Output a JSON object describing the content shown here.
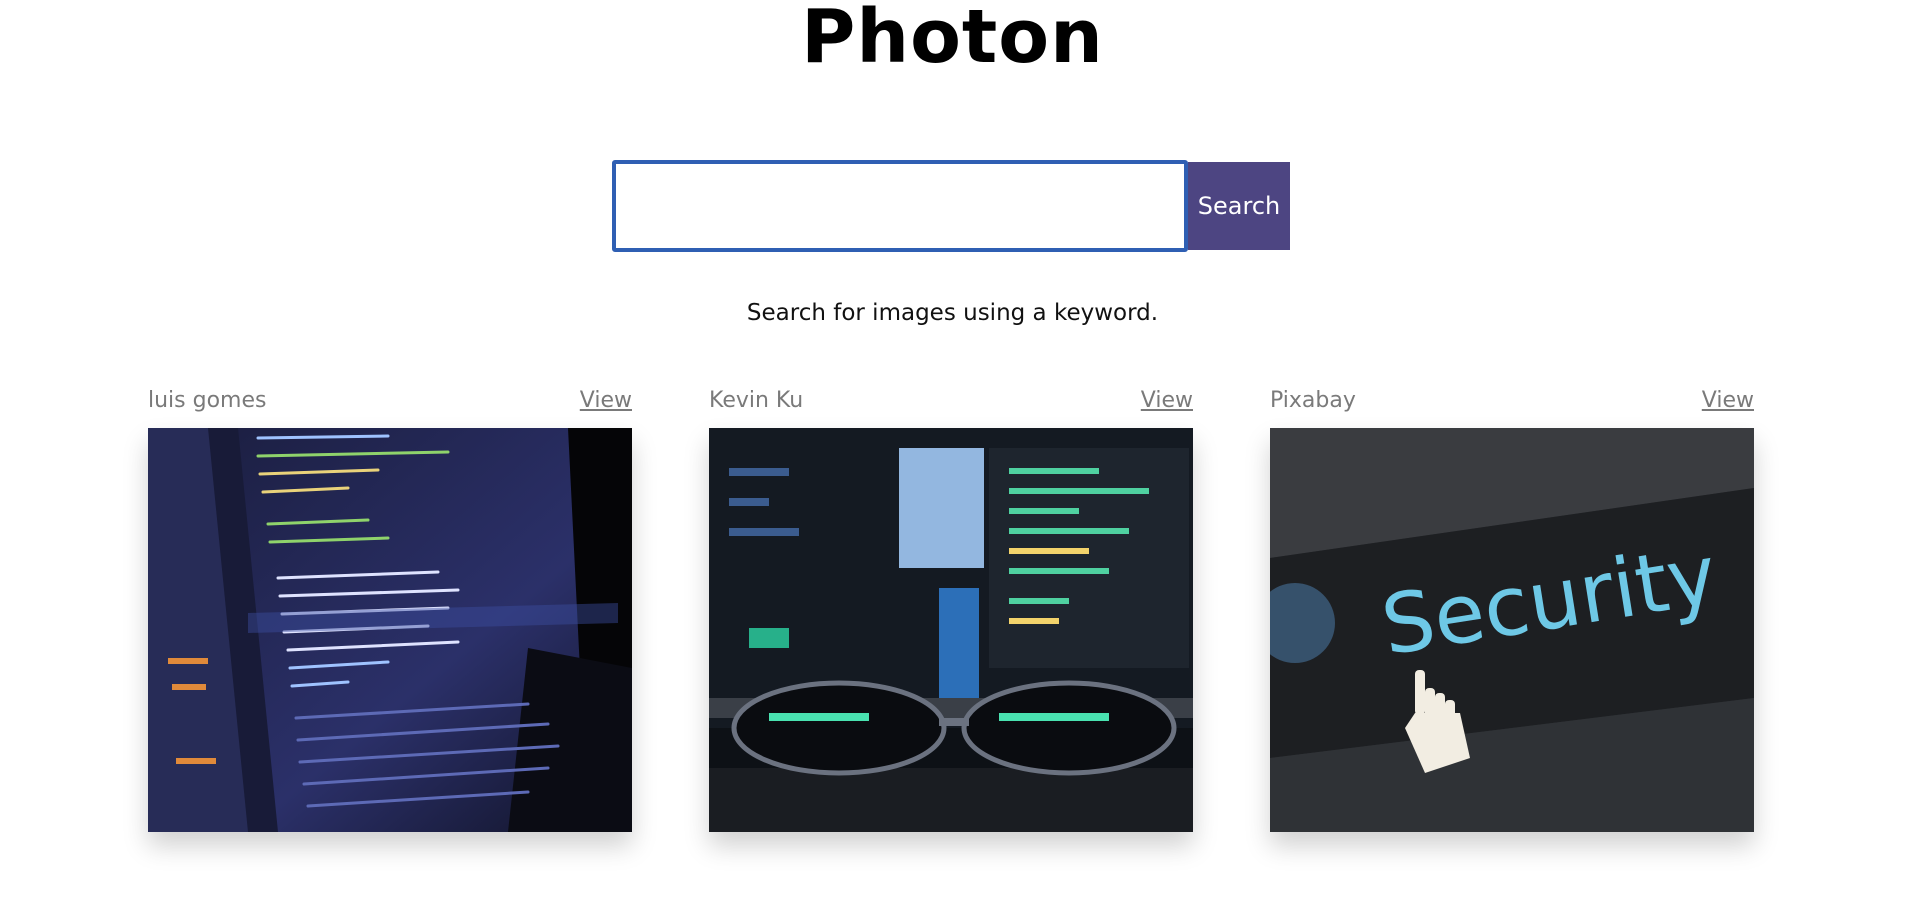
{
  "header": {
    "title": "Photon"
  },
  "search": {
    "value": "",
    "placeholder": "",
    "button_label": "Search",
    "hint": "Search for images using a keyword."
  },
  "results": [
    {
      "author": "luis gomes",
      "view_label": "View",
      "image": "code-editor-laptop"
    },
    {
      "author": "Kevin Ku",
      "view_label": "View",
      "image": "monitors-with-glasses"
    },
    {
      "author": "Pixabay",
      "view_label": "View",
      "image": "security-screen",
      "image_text": "Security"
    }
  ],
  "colors": {
    "accent_button": "#4d4582",
    "input_border": "#2f5fb3",
    "author_text": "#7a7a7a"
  }
}
